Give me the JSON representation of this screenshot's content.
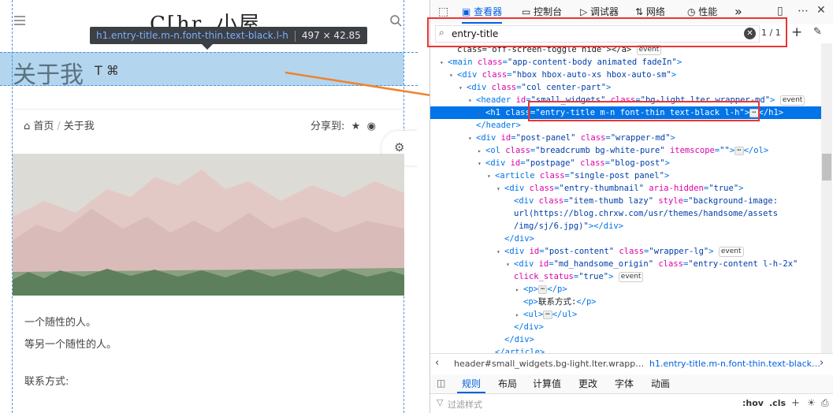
{
  "page": {
    "logo_text": "C[hr. 小屋",
    "tooltip": {
      "selector": "h1.entry-title.m-n.font-thin.text-black.l-h",
      "size": "497 × 42.85"
    },
    "title": "关于我",
    "title_icons": "T  ⌘",
    "breadcrumb": {
      "home": "首页",
      "current": "关于我"
    },
    "share_label": "分享到:",
    "body_lines": [
      "一个随性的人。",
      "等另一个随性的人。",
      "联系方式:"
    ]
  },
  "devtools": {
    "tabs": [
      "查看器",
      "控制台",
      "调试器",
      "网络",
      "性能"
    ],
    "more": "»",
    "search": {
      "value": "entry-title",
      "count": "1 / 1"
    },
    "tree": [
      {
        "depth": 5,
        "tw": "",
        "parts": [
          [
            "x",
            "class=\"off-screen-toggle hide\"></a>"
          ]
        ],
        "badge": "event"
      },
      {
        "depth": 4,
        "tw": "▾",
        "parts": [
          [
            "t",
            "<main "
          ],
          [
            "a",
            "class"
          ],
          [
            "t",
            "="
          ],
          [
            "v",
            "\"app-content-body animated fadeIn\""
          ],
          [
            "t",
            ">"
          ]
        ]
      },
      {
        "depth": 5,
        "tw": "▾",
        "parts": [
          [
            "t",
            "<div "
          ],
          [
            "a",
            "class"
          ],
          [
            "t",
            "="
          ],
          [
            "v",
            "\"hbox hbox-auto-xs hbox-auto-sm\""
          ],
          [
            "t",
            ">"
          ]
        ]
      },
      {
        "depth": 6,
        "tw": "▾",
        "parts": [
          [
            "t",
            "<div "
          ],
          [
            "a",
            "class"
          ],
          [
            "t",
            "="
          ],
          [
            "v",
            "\"col center-part\""
          ],
          [
            "t",
            ">"
          ]
        ]
      },
      {
        "depth": 7,
        "tw": "▾",
        "parts": [
          [
            "t",
            "<header "
          ],
          [
            "a",
            "id"
          ],
          [
            "t",
            "="
          ],
          [
            "v",
            "\"small_widgets\""
          ],
          [
            "t",
            " "
          ],
          [
            "a",
            "class"
          ],
          [
            "t",
            "="
          ],
          [
            "v",
            "\"bg-light lter wrapper-md\""
          ],
          [
            "t",
            ">"
          ]
        ],
        "badge": "event"
      },
      {
        "depth": 8,
        "tw": "▸",
        "sel": true,
        "parts": [
          [
            "t",
            "<h1 "
          ],
          [
            "a",
            "class"
          ],
          [
            "t",
            "="
          ],
          [
            "v",
            "\"entry-title m-n font-thin text-black l-h\""
          ],
          [
            "t",
            ">"
          ]
        ],
        "dots": true,
        "tail": "</h1>"
      },
      {
        "depth": 7,
        "tw": "",
        "parts": [
          [
            "t",
            "</header>"
          ]
        ]
      },
      {
        "depth": 7,
        "tw": "▾",
        "parts": [
          [
            "t",
            "<div "
          ],
          [
            "a",
            "id"
          ],
          [
            "t",
            "="
          ],
          [
            "v",
            "\"post-panel\""
          ],
          [
            "t",
            " "
          ],
          [
            "a",
            "class"
          ],
          [
            "t",
            "="
          ],
          [
            "v",
            "\"wrapper-md\""
          ],
          [
            "t",
            ">"
          ]
        ]
      },
      {
        "depth": 8,
        "tw": "▸",
        "parts": [
          [
            "t",
            "<ol "
          ],
          [
            "a",
            "class"
          ],
          [
            "t",
            "="
          ],
          [
            "v",
            "\"breadcrumb bg-white-pure\""
          ],
          [
            "t",
            " "
          ],
          [
            "a",
            "itemscope"
          ],
          [
            "t",
            "="
          ],
          [
            "v",
            "\"\""
          ],
          [
            "t",
            ">"
          ]
        ],
        "dots": true,
        "tail": "</ol>"
      },
      {
        "depth": 8,
        "tw": "▾",
        "parts": [
          [
            "t",
            "<div "
          ],
          [
            "a",
            "id"
          ],
          [
            "t",
            "="
          ],
          [
            "v",
            "\"postpage\""
          ],
          [
            "t",
            " "
          ],
          [
            "a",
            "class"
          ],
          [
            "t",
            "="
          ],
          [
            "v",
            "\"blog-post\""
          ],
          [
            "t",
            ">"
          ]
        ]
      },
      {
        "depth": 9,
        "tw": "▾",
        "parts": [
          [
            "t",
            "<article "
          ],
          [
            "a",
            "class"
          ],
          [
            "t",
            "="
          ],
          [
            "v",
            "\"single-post panel\""
          ],
          [
            "t",
            ">"
          ]
        ]
      },
      {
        "depth": 10,
        "tw": "▾",
        "parts": [
          [
            "t",
            "<div "
          ],
          [
            "a",
            "class"
          ],
          [
            "t",
            "="
          ],
          [
            "v",
            "\"entry-thumbnail\""
          ],
          [
            "t",
            " "
          ],
          [
            "a",
            "aria-hidden"
          ],
          [
            "t",
            "="
          ],
          [
            "v",
            "\"true\""
          ],
          [
            "t",
            ">"
          ]
        ]
      },
      {
        "depth": 11,
        "tw": "",
        "parts": [
          [
            "t",
            "<div "
          ],
          [
            "a",
            "class"
          ],
          [
            "t",
            "="
          ],
          [
            "v",
            "\"item-thumb lazy\""
          ],
          [
            "t",
            " "
          ],
          [
            "a",
            "style"
          ],
          [
            "t",
            "="
          ],
          [
            "v",
            "\"background-image:"
          ]
        ]
      },
      {
        "depth": 11,
        "tw": "",
        "parts": [
          [
            "v",
            "url(https://blog.chrxw.com/usr/themes/handsome/assets"
          ]
        ]
      },
      {
        "depth": 11,
        "tw": "",
        "parts": [
          [
            "v",
            "/img/sj/6.jpg)\""
          ],
          [
            "t",
            "></div>"
          ]
        ]
      },
      {
        "depth": 10,
        "tw": "",
        "parts": [
          [
            "t",
            "</div>"
          ]
        ]
      },
      {
        "depth": 10,
        "tw": "▾",
        "parts": [
          [
            "t",
            "<div "
          ],
          [
            "a",
            "id"
          ],
          [
            "t",
            "="
          ],
          [
            "v",
            "\"post-content\""
          ],
          [
            "t",
            " "
          ],
          [
            "a",
            "class"
          ],
          [
            "t",
            "="
          ],
          [
            "v",
            "\"wrapper-lg\""
          ],
          [
            "t",
            ">"
          ]
        ],
        "badge": "event"
      },
      {
        "depth": 11,
        "tw": "▾",
        "parts": [
          [
            "t",
            "<div "
          ],
          [
            "a",
            "id"
          ],
          [
            "t",
            "="
          ],
          [
            "v",
            "\"md_handsome_origin\""
          ],
          [
            "t",
            " "
          ],
          [
            "a",
            "class"
          ],
          [
            "t",
            "="
          ],
          [
            "v",
            "\"entry-content l-h-2x\""
          ]
        ]
      },
      {
        "depth": 11,
        "tw": "",
        "parts": [
          [
            "a",
            "click_status"
          ],
          [
            "t",
            "="
          ],
          [
            "v",
            "\"true\""
          ],
          [
            "t",
            ">"
          ]
        ],
        "badge": "event"
      },
      {
        "depth": 12,
        "tw": "▸",
        "parts": [
          [
            "t",
            "<p>"
          ]
        ],
        "dots": true,
        "tail": "</p>"
      },
      {
        "depth": 12,
        "tw": "",
        "parts": [
          [
            "t",
            "<p>"
          ],
          [
            "x",
            "联系方式:"
          ],
          [
            "t",
            "</p>"
          ]
        ]
      },
      {
        "depth": 12,
        "tw": "▸",
        "parts": [
          [
            "t",
            "<ul>"
          ]
        ],
        "dots": true,
        "tail": "</ul>"
      },
      {
        "depth": 11,
        "tw": "",
        "parts": [
          [
            "t",
            "</div>"
          ]
        ]
      },
      {
        "depth": 10,
        "tw": "",
        "parts": [
          [
            "t",
            "</div>"
          ]
        ]
      },
      {
        "depth": 9,
        "tw": "",
        "parts": [
          [
            "t",
            "</article>"
          ]
        ]
      }
    ],
    "breadcrumbs": [
      "header#small_widgets.bg-light.lter.wrapp…",
      "h1.entry-title.m-n.font-thin.text-black…"
    ],
    "rule_tabs": [
      "规则",
      "布局",
      "计算值",
      "更改",
      "字体",
      "动画"
    ],
    "filter_placeholder": "过滤样式",
    "filter_hov": ":hov",
    "filter_cls": ".cls",
    "colors": {
      "accent": "#0074e8",
      "highlight": "#b3d5ee",
      "annotation": "#e33",
      "arrow": "#f0822a"
    }
  }
}
